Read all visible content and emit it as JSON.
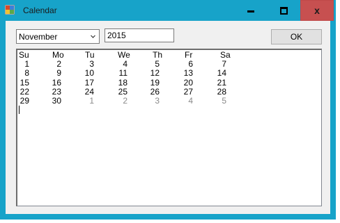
{
  "window": {
    "title": "Calendar",
    "close_glyph": "x",
    "icons": {
      "app": "calendar-app-icon",
      "minimize": "minimize-icon",
      "maximize": "maximize-icon",
      "close": "close-icon"
    },
    "colors": {
      "frame": "#17a3c9",
      "close": "#c75050",
      "client": "#f0f0f0"
    }
  },
  "controls": {
    "month": "November",
    "year": "2015",
    "ok_label": "OK"
  },
  "calendar": {
    "weekdays": [
      "Su",
      "Mo",
      "Tu",
      "We",
      "Th",
      "Fr",
      "Sa"
    ],
    "weeks": [
      [
        "1",
        "2",
        "3",
        "4",
        "5",
        "6",
        "7"
      ],
      [
        "8",
        "9",
        "10",
        "11",
        "12",
        "13",
        "14"
      ],
      [
        "15",
        "16",
        "17",
        "18",
        "19",
        "20",
        "21"
      ],
      [
        "22",
        "23",
        "24",
        "25",
        "26",
        "27",
        "28"
      ],
      [
        "29",
        "30",
        "1",
        "2",
        "3",
        "4",
        "5"
      ]
    ],
    "next_month_days_in_last_week": 5
  }
}
